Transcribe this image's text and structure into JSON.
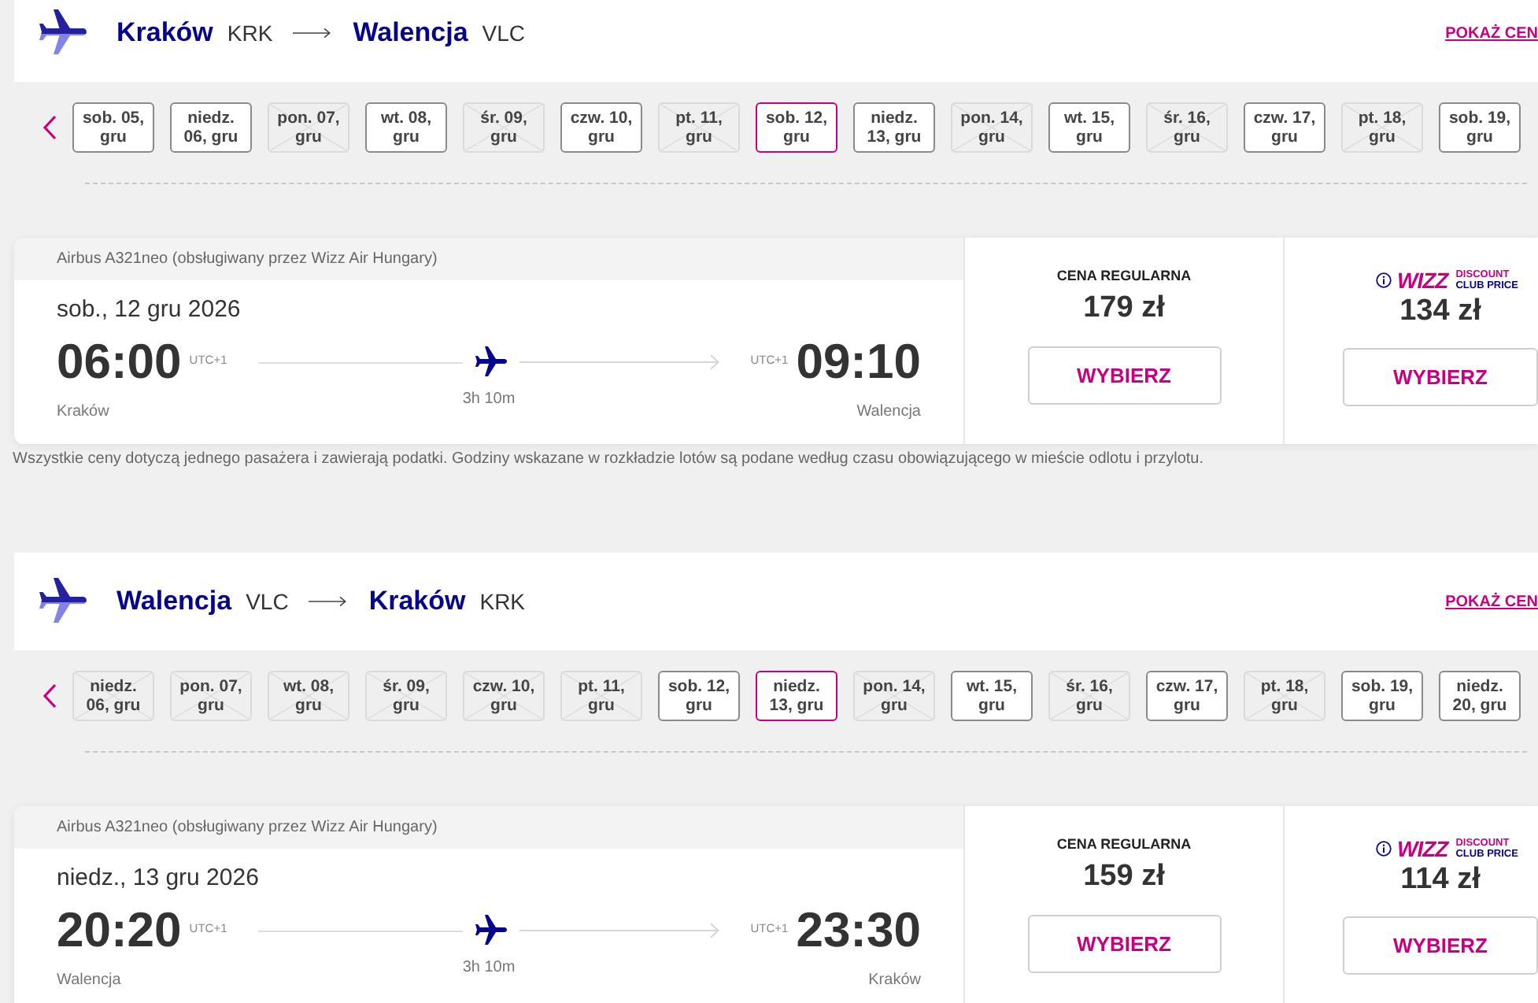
{
  "legs": [
    {
      "header": {
        "origin": {
          "city": "Kraków",
          "code": "KRK"
        },
        "destination": {
          "city": "Walencja",
          "code": "VLC"
        },
        "link": "POKAŻ CEN"
      },
      "dates": [
        {
          "label": "sob. 05, gru",
          "available": true,
          "selected": false
        },
        {
          "label": "niedz. 06, gru",
          "available": true,
          "selected": false
        },
        {
          "label": "pon. 07, gru",
          "available": false,
          "selected": false
        },
        {
          "label": "wt. 08, gru",
          "available": true,
          "selected": false
        },
        {
          "label": "śr. 09, gru",
          "available": false,
          "selected": false
        },
        {
          "label": "czw. 10, gru",
          "available": true,
          "selected": false
        },
        {
          "label": "pt. 11, gru",
          "available": false,
          "selected": false
        },
        {
          "label": "sob. 12, gru",
          "available": true,
          "selected": true
        },
        {
          "label": "niedz. 13, gru",
          "available": true,
          "selected": false
        },
        {
          "label": "pon. 14, gru",
          "available": false,
          "selected": false
        },
        {
          "label": "wt. 15, gru",
          "available": true,
          "selected": false
        },
        {
          "label": "śr. 16, gru",
          "available": false,
          "selected": false
        },
        {
          "label": "czw. 17, gru",
          "available": true,
          "selected": false
        },
        {
          "label": "pt. 18, gru",
          "available": false,
          "selected": false
        },
        {
          "label": "sob. 19, gru",
          "available": true,
          "selected": false
        }
      ],
      "flight": {
        "aircraft": "Airbus A321neo (obsługiwany przez Wizz Air Hungary)",
        "date": "sob., 12 gru 2026",
        "departure": {
          "time": "06:00",
          "tz": "UTC+1",
          "city": "Kraków"
        },
        "arrival": {
          "time": "09:10",
          "tz": "UTC+1",
          "city": "Walencja"
        },
        "duration": "3h 10m"
      },
      "fares": [
        {
          "kind": "regular",
          "label": "CENA REGULARNA",
          "price": "179 zł",
          "button": "WYBIERZ"
        },
        {
          "kind": "club",
          "logo_word": "WIZZ",
          "logo_lines": [
            "DISCOUNT",
            "CLUB PRICE"
          ],
          "price": "134 zł",
          "button": "WYBIERZ"
        }
      ],
      "footnote": "Wszystkie ceny dotyczą jednego pasażera i zawierają podatki. Godziny wskazane w rozkładzie lotów są podane według czasu obowiązującego w mieście odlotu i przylotu."
    },
    {
      "header": {
        "origin": {
          "city": "Walencja",
          "code": "VLC"
        },
        "destination": {
          "city": "Kraków",
          "code": "KRK"
        },
        "link": "POKAŻ CEN"
      },
      "dates": [
        {
          "label": "niedz. 06, gru",
          "available": false,
          "selected": false
        },
        {
          "label": "pon. 07, gru",
          "available": false,
          "selected": false
        },
        {
          "label": "wt. 08, gru",
          "available": false,
          "selected": false
        },
        {
          "label": "śr. 09, gru",
          "available": false,
          "selected": false
        },
        {
          "label": "czw. 10, gru",
          "available": false,
          "selected": false
        },
        {
          "label": "pt. 11, gru",
          "available": false,
          "selected": false
        },
        {
          "label": "sob. 12, gru",
          "available": true,
          "selected": false
        },
        {
          "label": "niedz. 13, gru",
          "available": true,
          "selected": true
        },
        {
          "label": "pon. 14, gru",
          "available": false,
          "selected": false
        },
        {
          "label": "wt. 15, gru",
          "available": true,
          "selected": false
        },
        {
          "label": "śr. 16, gru",
          "available": false,
          "selected": false
        },
        {
          "label": "czw. 17, gru",
          "available": true,
          "selected": false
        },
        {
          "label": "pt. 18, gru",
          "available": false,
          "selected": false
        },
        {
          "label": "sob. 19, gru",
          "available": true,
          "selected": false
        },
        {
          "label": "niedz. 20, gru",
          "available": true,
          "selected": false
        }
      ],
      "flight": {
        "aircraft": "Airbus A321neo (obsługiwany przez Wizz Air Hungary)",
        "date": "niedz., 13 gru 2026",
        "departure": {
          "time": "20:20",
          "tz": "UTC+1",
          "city": "Walencja"
        },
        "arrival": {
          "time": "23:30",
          "tz": "UTC+1",
          "city": "Kraków"
        },
        "duration": "3h 10m"
      },
      "fares": [
        {
          "kind": "regular",
          "label": "CENA REGULARNA",
          "price": "159 zł",
          "button": "WYBIERZ"
        },
        {
          "kind": "club",
          "logo_word": "WIZZ",
          "logo_lines": [
            "DISCOUNT",
            "CLUB PRICE"
          ],
          "price": "114 zł",
          "button": "WYBIERZ"
        }
      ]
    }
  ]
}
